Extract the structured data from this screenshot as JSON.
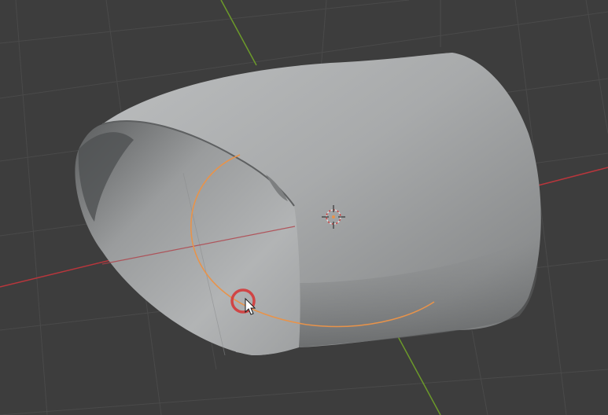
{
  "viewport": {
    "background_color": "#3d3d3d",
    "grid_color": "#4a4a4a",
    "x_axis_color": "#b8363c",
    "y_axis_color": "#6c9a2a"
  },
  "object": {
    "type": "curved-pipe-mesh",
    "shading": "solid",
    "surface_color": "#a9abac"
  },
  "curve": {
    "color": "#e8934a",
    "selected": true
  },
  "origin": {
    "icon": "3d-cursor-icon"
  },
  "cursor": {
    "icon": "mouse-pointer-icon",
    "click_indicator_color": "#d43a3a"
  }
}
